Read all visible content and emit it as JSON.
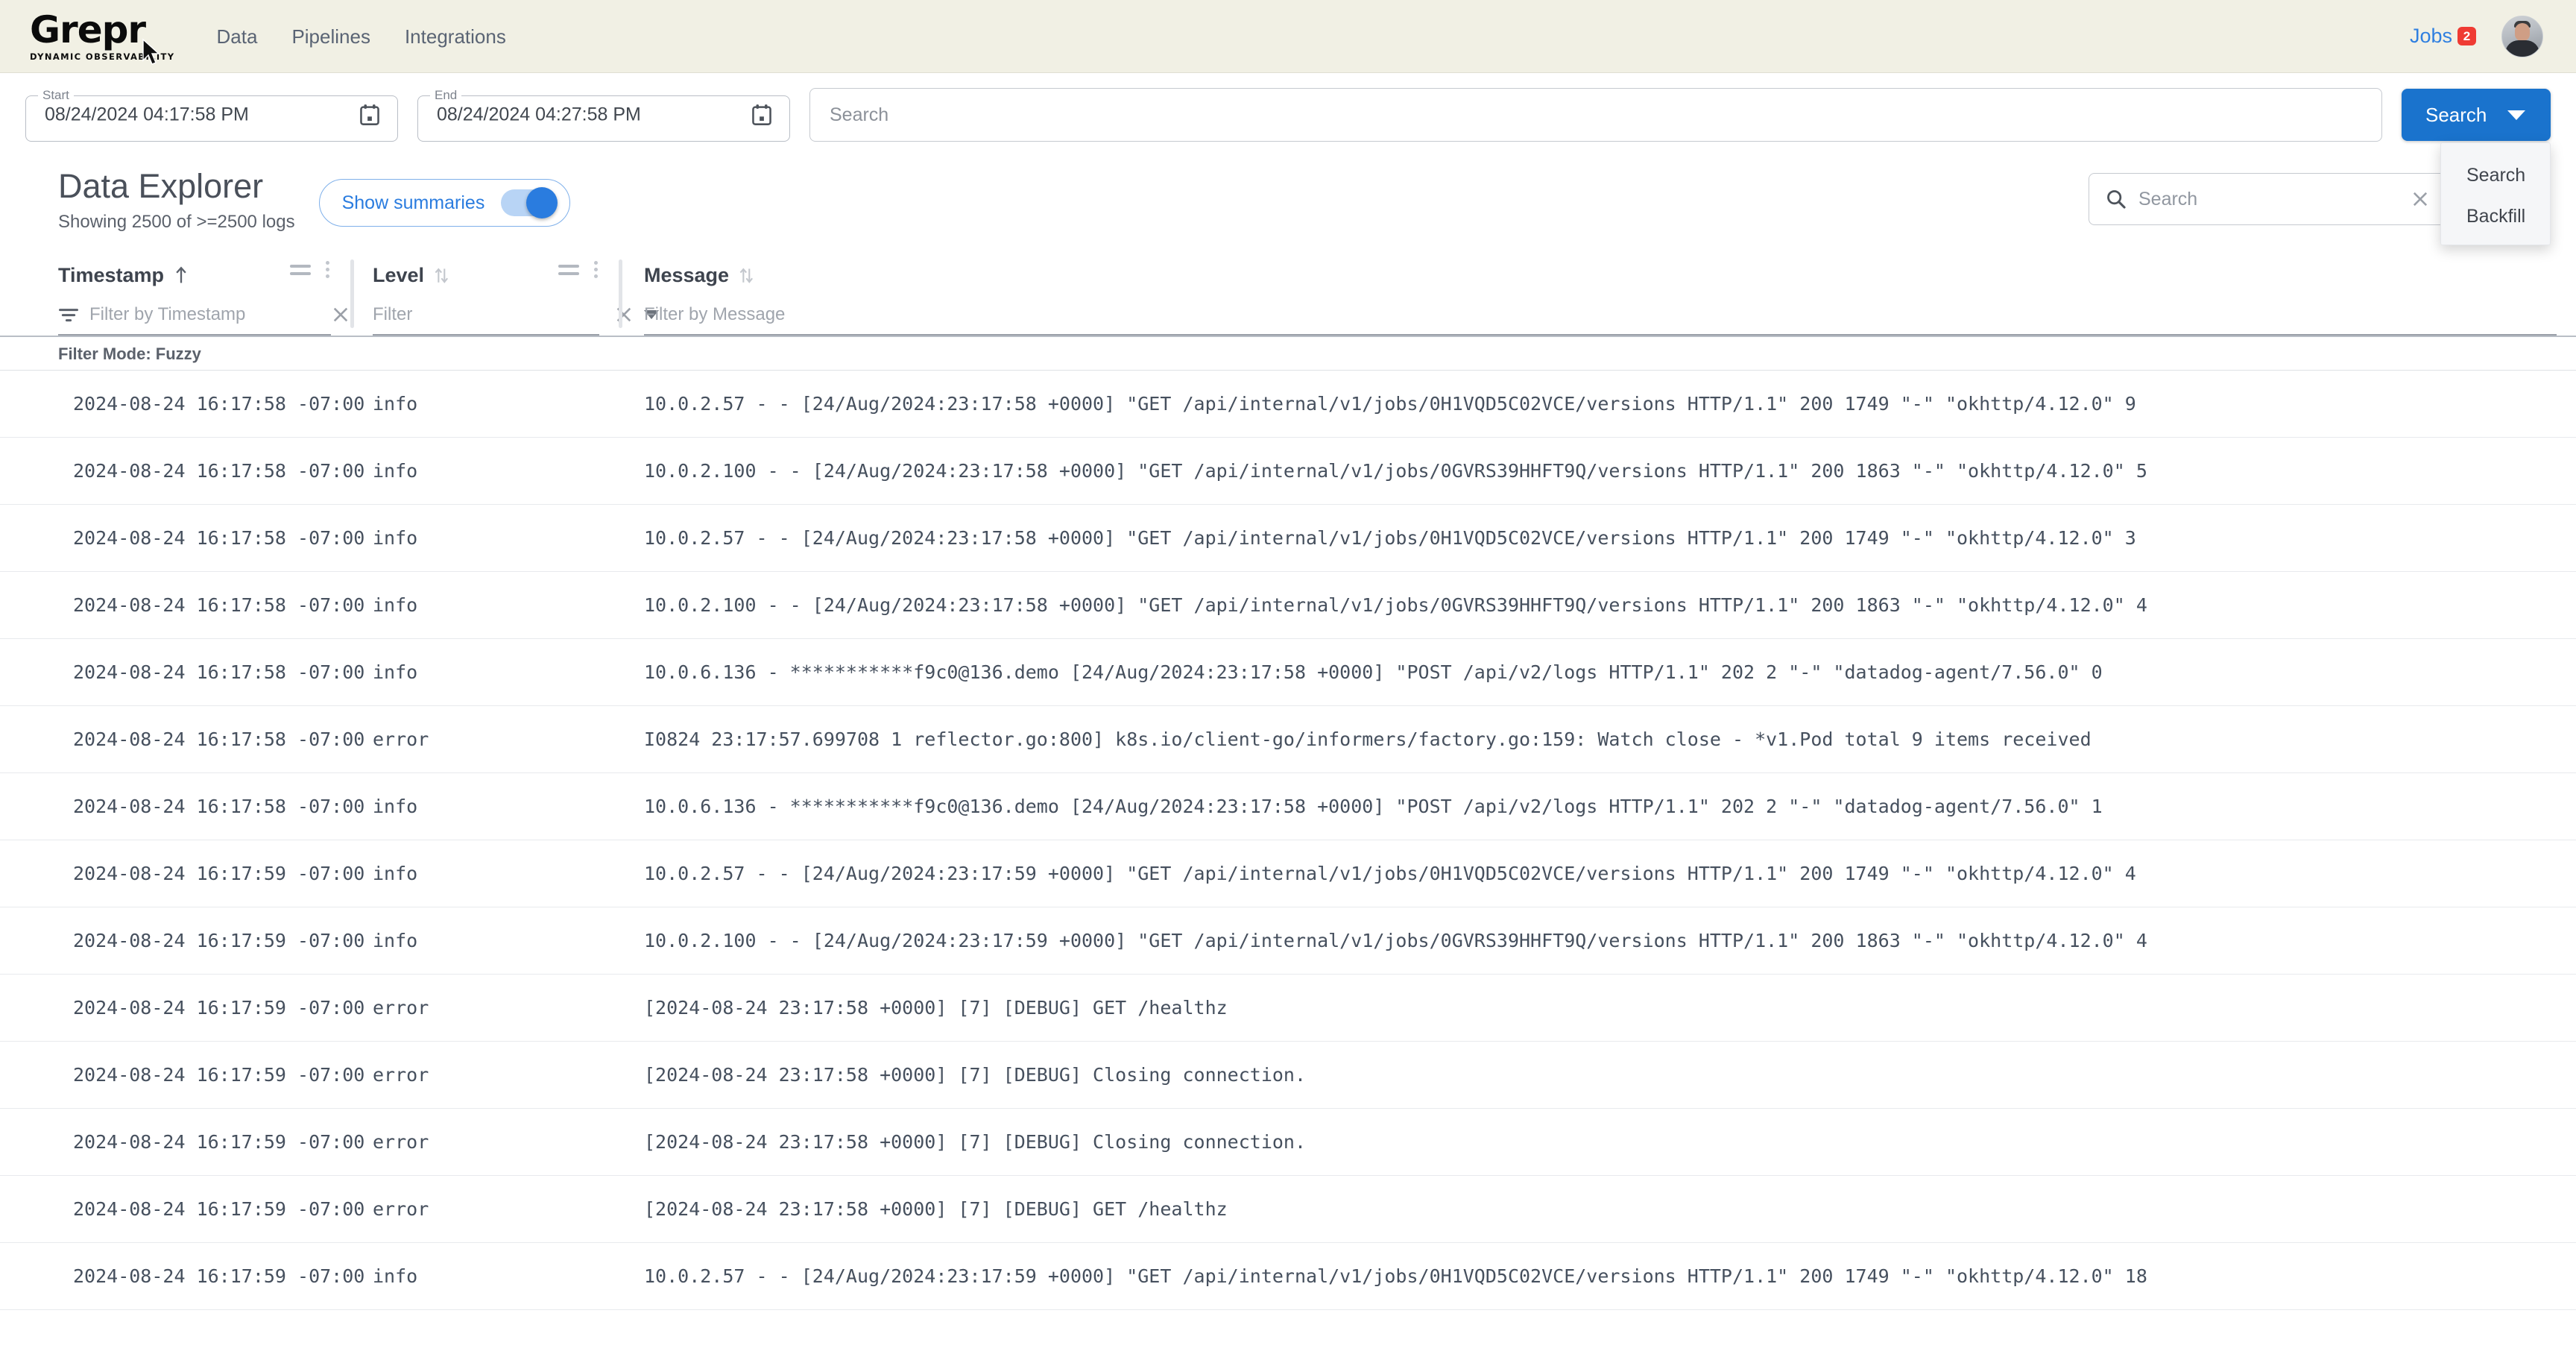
{
  "topnav": {
    "brand_word": "Grepr",
    "brand_tagline": "DYNAMIC OBSERVABILITY",
    "links": [
      {
        "label": "Data"
      },
      {
        "label": "Pipelines"
      },
      {
        "label": "Integrations"
      }
    ],
    "jobs_label": "Jobs",
    "jobs_badge": "2",
    "accent_color": "#2f7fe0",
    "badge_color": "#ef3b33",
    "bar_color": "#f1f0e4"
  },
  "searchbar": {
    "start_label": "Start",
    "start_value": "08/24/2024 04:17:58 PM",
    "end_label": "End",
    "end_value": "08/24/2024 04:27:58 PM",
    "search_placeholder": "Search",
    "search_value": "",
    "search_button": "Search",
    "menu": [
      {
        "label": "Search"
      },
      {
        "label": "Backfill"
      }
    ],
    "button_color": "#1a73cd"
  },
  "explorer": {
    "title": "Data Explorer",
    "subtitle": "Showing 2500 of >=2500 logs",
    "toggle_label": "Show summaries",
    "toggle_on": true,
    "table_search_placeholder": "Search",
    "table_search_value": ""
  },
  "table": {
    "columns": [
      {
        "title": "Timestamp",
        "sort": "asc",
        "filter_placeholder": "Filter by Timestamp"
      },
      {
        "title": "Level",
        "sort": "none",
        "filter_placeholder": "Filter"
      },
      {
        "title": "Message",
        "sort": "none",
        "filter_placeholder": "Filter by Message"
      }
    ],
    "filter_mode": "Filter Mode: Fuzzy",
    "rows": [
      {
        "timestamp": "2024-08-24 16:17:58 -07:00",
        "level": "info",
        "message": "10.0.2.57 - - [24/Aug/2024:23:17:58 +0000] \"GET /api/internal/v1/jobs/0H1VQD5C02VCE/versions HTTP/1.1\" 200 1749 \"-\" \"okhttp/4.12.0\" 9"
      },
      {
        "timestamp": "2024-08-24 16:17:58 -07:00",
        "level": "info",
        "message": "10.0.2.100 - - [24/Aug/2024:23:17:58 +0000] \"GET /api/internal/v1/jobs/0GVRS39HHFT9Q/versions HTTP/1.1\" 200 1863 \"-\" \"okhttp/4.12.0\" 5"
      },
      {
        "timestamp": "2024-08-24 16:17:58 -07:00",
        "level": "info",
        "message": "10.0.2.57 - - [24/Aug/2024:23:17:58 +0000] \"GET /api/internal/v1/jobs/0H1VQD5C02VCE/versions HTTP/1.1\" 200 1749 \"-\" \"okhttp/4.12.0\" 3"
      },
      {
        "timestamp": "2024-08-24 16:17:58 -07:00",
        "level": "info",
        "message": "10.0.2.100 - - [24/Aug/2024:23:17:58 +0000] \"GET /api/internal/v1/jobs/0GVRS39HHFT9Q/versions HTTP/1.1\" 200 1863 \"-\" \"okhttp/4.12.0\" 4"
      },
      {
        "timestamp": "2024-08-24 16:17:58 -07:00",
        "level": "info",
        "message": "10.0.6.136 - ***********f9c0@136.demo [24/Aug/2024:23:17:58 +0000] \"POST /api/v2/logs HTTP/1.1\" 202 2 \"-\" \"datadog-agent/7.56.0\" 0"
      },
      {
        "timestamp": "2024-08-24 16:17:58 -07:00",
        "level": "error",
        "message": "I0824 23:17:57.699708 1 reflector.go:800] k8s.io/client-go/informers/factory.go:159: Watch close - *v1.Pod total 9 items received"
      },
      {
        "timestamp": "2024-08-24 16:17:58 -07:00",
        "level": "info",
        "message": "10.0.6.136 - ***********f9c0@136.demo [24/Aug/2024:23:17:58 +0000] \"POST /api/v2/logs HTTP/1.1\" 202 2 \"-\" \"datadog-agent/7.56.0\" 1"
      },
      {
        "timestamp": "2024-08-24 16:17:59 -07:00",
        "level": "info",
        "message": "10.0.2.57 - - [24/Aug/2024:23:17:59 +0000] \"GET /api/internal/v1/jobs/0H1VQD5C02VCE/versions HTTP/1.1\" 200 1749 \"-\" \"okhttp/4.12.0\" 4"
      },
      {
        "timestamp": "2024-08-24 16:17:59 -07:00",
        "level": "info",
        "message": "10.0.2.100 - - [24/Aug/2024:23:17:59 +0000] \"GET /api/internal/v1/jobs/0GVRS39HHFT9Q/versions HTTP/1.1\" 200 1863 \"-\" \"okhttp/4.12.0\" 4"
      },
      {
        "timestamp": "2024-08-24 16:17:59 -07:00",
        "level": "error",
        "message": "[2024-08-24 23:17:58 +0000] [7] [DEBUG] GET /healthz"
      },
      {
        "timestamp": "2024-08-24 16:17:59 -07:00",
        "level": "error",
        "message": "[2024-08-24 23:17:58 +0000] [7] [DEBUG] Closing connection."
      },
      {
        "timestamp": "2024-08-24 16:17:59 -07:00",
        "level": "error",
        "message": "[2024-08-24 23:17:58 +0000] [7] [DEBUG] Closing connection."
      },
      {
        "timestamp": "2024-08-24 16:17:59 -07:00",
        "level": "error",
        "message": "[2024-08-24 23:17:58 +0000] [7] [DEBUG] GET /healthz"
      },
      {
        "timestamp": "2024-08-24 16:17:59 -07:00",
        "level": "info",
        "message": "10.0.2.57 - - [24/Aug/2024:23:17:59 +0000] \"GET /api/internal/v1/jobs/0H1VQD5C02VCE/versions HTTP/1.1\" 200 1749 \"-\" \"okhttp/4.12.0\" 18"
      }
    ]
  }
}
